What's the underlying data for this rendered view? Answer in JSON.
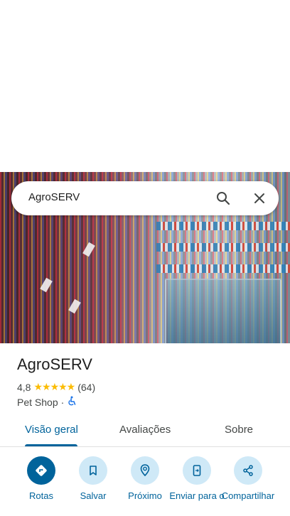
{
  "search": {
    "value": "AgroSERV"
  },
  "place": {
    "name": "AgroSERV",
    "rating": "4,8",
    "stars": "★★★★★",
    "review_count": "(64)",
    "category": "Pet Shop",
    "separator": "·"
  },
  "tabs": [
    "Visão geral",
    "Avaliações",
    "Sobre"
  ],
  "actions": [
    "Rotas",
    "Salvar",
    "Próximo",
    "Enviar para o",
    "Compartilhar"
  ],
  "colors": {
    "accent": "#00639b",
    "chip_bg": "#cfe9f7",
    "star": "#fbbc04"
  }
}
